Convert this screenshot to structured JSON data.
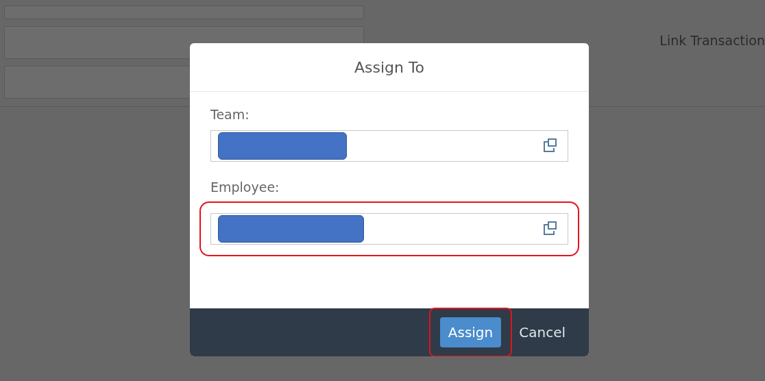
{
  "background": {
    "link_label": "Link Transaction"
  },
  "dialog": {
    "title": "Assign To",
    "fields": [
      {
        "label": "Team:",
        "redacted": true,
        "highlighted": false
      },
      {
        "label": "Employee:",
        "redacted": true,
        "highlighted": true
      }
    ],
    "buttons": [
      {
        "label": "Assign",
        "kind": "primary",
        "highlighted": true
      },
      {
        "label": "Cancel",
        "kind": "plain",
        "highlighted": false
      }
    ]
  }
}
